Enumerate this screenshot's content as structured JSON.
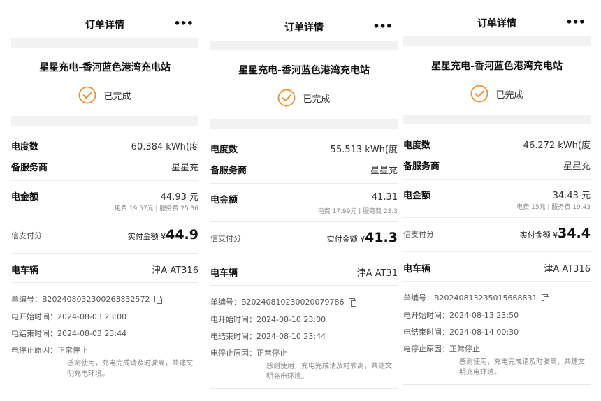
{
  "header": {
    "title": "订单详情",
    "more": "•••"
  },
  "station": "星星充电-香河蓝色港湾充电站",
  "status": "已完成",
  "colors": {
    "accent": "#e0933a"
  },
  "labels": {
    "energy": "电度数",
    "provider": "备服务商",
    "amount": "电金额",
    "credit": "信支付分",
    "pay_prefix": "实付金额 ¥",
    "vehicle": "电车辆",
    "order_no": "单编号：",
    "start": "电开始时间：",
    "end": "电结束时间：",
    "stop": "电停止原因：",
    "stop_value": "正常停止",
    "notice": "感谢使用，充电完成请及时驶离，共建文明充电环境。"
  },
  "orders": [
    {
      "energy": "60.384 kWh(度",
      "provider": "星星充",
      "amount": "44.93 元",
      "breakdown": "电费 19.57元 | 服务费 25.36",
      "paid": "44.9",
      "vehicle": "津A AT316",
      "order_no": "B202408032300263832572",
      "start": "2024-08-03 23:00",
      "end": "2024-08-03 23:44"
    },
    {
      "energy": "55.513 kWh(度",
      "provider": "星星充",
      "amount": "41.31",
      "breakdown": "电费 17.99元 | 服务费 23.3",
      "paid": "41.3",
      "vehicle": "津A AT31",
      "order_no": "B20240810230020079786",
      "start": "2024-08-10 23:00",
      "end": "2024-08-10 23:44"
    },
    {
      "energy": "46.272 kWh(度",
      "provider": "星星充",
      "amount": "34.43 元",
      "breakdown": "电费 15元 | 服务费 19.43",
      "paid": "34.4",
      "vehicle": "津A AT316",
      "order_no": "B20240813235015668831",
      "start": "2024-08-13 23:50",
      "end": "2024-08-14 00:30"
    }
  ]
}
